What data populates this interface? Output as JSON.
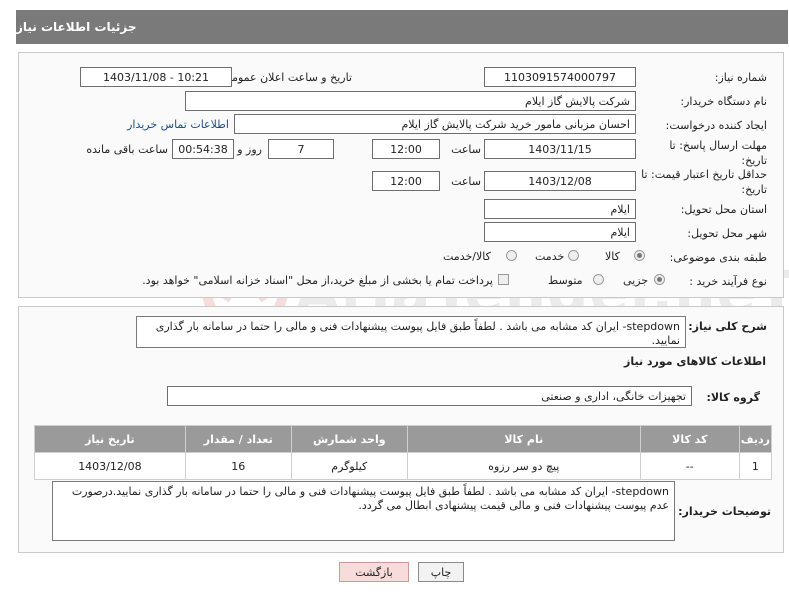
{
  "header": {
    "title": "جزئیات اطلاعات نیاز"
  },
  "fields": {
    "need_number_label": "شماره نیاز:",
    "need_number": "1103091574000797",
    "announce_label": "تاریخ و ساعت اعلان عمومی:",
    "announce_value": "1403/11/08 - 10:21",
    "buyer_org_label": "نام دستگاه خریدار:",
    "buyer_org": "شرکت پالایش گاز ایلام",
    "requester_label": "ایجاد کننده درخواست:",
    "requester": "احسان مزبانی مامور خرید شرکت پالایش گاز ایلام",
    "contact_link": "اطلاعات تماس خریدار",
    "deadline_label": "مهلت ارسال پاسخ: تا تاریخ:",
    "deadline_date": "1403/11/15",
    "time_label": "ساعت",
    "deadline_time": "12:00",
    "days": "7",
    "days_label": "روز و",
    "remaining": "00:54:38",
    "remaining_label": "ساعت باقی مانده",
    "validity_label": "حداقل تاریخ اعتبار قیمت: تا تاریخ:",
    "validity_date": "1403/12/08",
    "validity_time": "12:00",
    "province_label": "استان محل تحویل:",
    "province": "ایلام",
    "city_label": "شهر محل تحویل:",
    "city": "ایلام",
    "category_label": "طبقه بندی موضوعی:",
    "category_options": [
      "کالا",
      "خدمت",
      "کالا/خدمت"
    ],
    "process_label": "نوع فرآیند خرید :",
    "process_options": [
      "جزیی",
      "متوسط"
    ],
    "payment_note": "پرداخت تمام یا بخشی از مبلغ خرید،از محل \"اسناد خزانه اسلامی\" خواهد بود."
  },
  "description": {
    "label": "شرح کلی نیاز:",
    "text": "stepdown- ایران کد مشابه می باشد . لطفاً طبق فایل پیوست پیشنهادات فنی و مالی را حتما در سامانه بار گذاری نمایید."
  },
  "goods": {
    "section_title": "اطلاعات کالاهای مورد نیاز",
    "group_label": "گروه کالا:",
    "group_value": "تجهیزات خانگی، اداری و صنعتی",
    "columns": [
      "ردیف",
      "کد کالا",
      "نام کالا",
      "واحد شمارش",
      "تعداد / مقدار",
      "تاریخ نیاز"
    ],
    "rows": [
      {
        "row": "1",
        "code": "--",
        "name": "پیچ دو سر رزوه",
        "unit": "کیلوگرم",
        "qty": "16",
        "date": "1403/12/08"
      }
    ]
  },
  "buyer_notes": {
    "label": "توضیحات خریدار:",
    "text": "stepdown- ایران کد مشابه می باشد . لطفاً طبق فایل پیوست پیشنهادات فنی و مالی را حتما در سامانه بار گذاری نمایید.درصورت عدم پیوست پیشنهادات فنی و مالی قیمت پیشنهادی ابطال می گردد."
  },
  "buttons": {
    "print": "چاپ",
    "back": "بازگشت"
  },
  "watermark": "AriaTender.neT",
  "colors": {
    "header_bg": "#7a7a7a",
    "link": "#1a4f8a",
    "back_button": "#f8dcdc"
  }
}
